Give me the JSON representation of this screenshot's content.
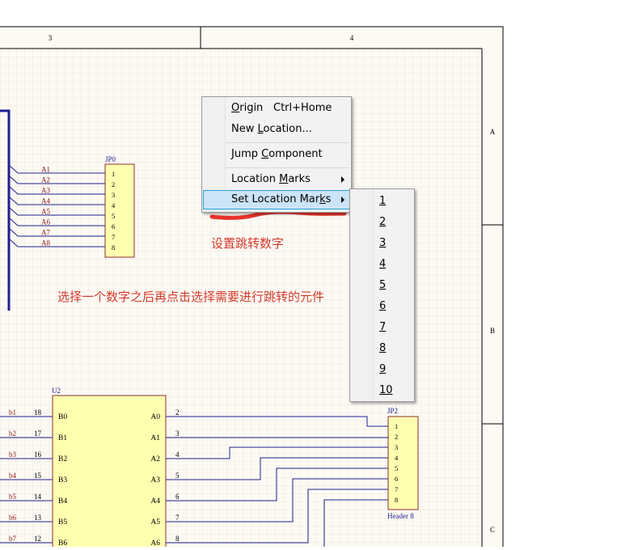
{
  "schematic": {
    "column_labels": [
      "3",
      "4"
    ],
    "row_labels": [
      "A",
      "B",
      "C"
    ],
    "jp0": {
      "designator": "JP0",
      "net_labels": [
        "A1",
        "A2",
        "A3",
        "A4",
        "A5",
        "A6",
        "A7",
        "A8"
      ],
      "pins": [
        "1",
        "2",
        "3",
        "4",
        "5",
        "6",
        "7",
        "8"
      ]
    },
    "u2": {
      "designator": "U2",
      "left_pins": [
        {
          "net": "b1",
          "num": "18",
          "name": "B0"
        },
        {
          "net": "b2",
          "num": "17",
          "name": "B1"
        },
        {
          "net": "b3",
          "num": "16",
          "name": "B2"
        },
        {
          "net": "b4",
          "num": "15",
          "name": "B3"
        },
        {
          "net": "b5",
          "num": "14",
          "name": "B4"
        },
        {
          "net": "b6",
          "num": "13",
          "name": "B5"
        },
        {
          "net": "b7",
          "num": "12",
          "name": "B6"
        }
      ],
      "right_pins": [
        {
          "num": "2",
          "name": "A0"
        },
        {
          "num": "3",
          "name": "A1"
        },
        {
          "num": "4",
          "name": "A2"
        },
        {
          "num": "5",
          "name": "A3"
        },
        {
          "num": "6",
          "name": "A4"
        },
        {
          "num": "7",
          "name": "A5"
        },
        {
          "num": "8",
          "name": "A6"
        }
      ]
    },
    "jp2": {
      "designator": "JP2",
      "comment": "Header 8",
      "pins": [
        "1",
        "2",
        "3",
        "4",
        "5",
        "6",
        "7",
        "8"
      ]
    }
  },
  "context_menu": {
    "items": [
      {
        "pre": "",
        "u": "O",
        "post": "rigin",
        "shortcut": "Ctrl+Home"
      },
      {
        "pre": "New ",
        "u": "L",
        "post": "ocation...",
        "shortcut": ""
      },
      {
        "pre": "Jump ",
        "u": "C",
        "post": "omponent",
        "shortcut": ""
      },
      {
        "pre": "Location ",
        "u": "M",
        "post": "arks",
        "shortcut": ""
      },
      {
        "pre": "Set Location Mar",
        "u": "k",
        "post": "s",
        "shortcut": ""
      }
    ],
    "highlighted_index": 4
  },
  "submenu": {
    "items": [
      "1",
      "2",
      "3",
      "4",
      "5",
      "6",
      "7",
      "8",
      "9",
      "10"
    ]
  },
  "annotations": {
    "label_set_number": "设置跳转数字",
    "label_instructions": "选择一个数字之后再点击选择需要进行跳转的元件"
  },
  "colors": {
    "sheet_bg": "#fdfaf4",
    "grid": "#ede7df",
    "wire": "#1f1f8f",
    "component_fill": "#ffffb0",
    "component_border": "#8b2e2e",
    "net_label": "#8b1a1a",
    "annotation_red": "#d23c2c",
    "menu_highlight": "#cce4f7"
  }
}
